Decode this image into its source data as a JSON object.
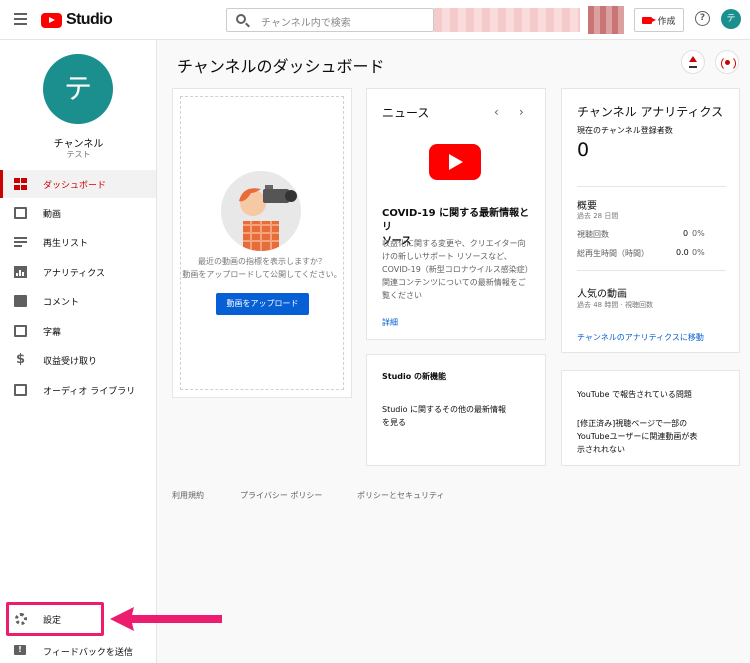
{
  "header": {
    "logo_text": "Studio",
    "search_placeholder": "チャンネル内で検索",
    "create_label": "作成",
    "help_label": "?",
    "avatar_initial": "テ"
  },
  "sidebar": {
    "avatar_initial": "テ",
    "channel_name": "チャンネル",
    "channel_sub": "テスト",
    "items": [
      {
        "label": "ダッシュボード",
        "icon": "dashboard-icon"
      },
      {
        "label": "動画",
        "icon": "video-icon"
      },
      {
        "label": "再生リスト",
        "icon": "playlist-icon"
      },
      {
        "label": "アナリティクス",
        "icon": "analytics-icon"
      },
      {
        "label": "コメント",
        "icon": "comment-icon"
      },
      {
        "label": "字幕",
        "icon": "subtitles-icon"
      },
      {
        "label": "収益受け取り",
        "icon": "dollar-icon"
      },
      {
        "label": "オーディオ ライブラリ",
        "icon": "audio-library-icon"
      }
    ],
    "settings_label": "設定",
    "feedback_label": "フィードバックを送信"
  },
  "main": {
    "title": "チャンネルのダッシュボード",
    "upload_card": {
      "text_line1": "最近の動画の指標を表示しますか？",
      "text_line2": "動画をアップロードして公開してください。",
      "button": "動画をアップロード"
    },
    "news": {
      "heading": "ニュース",
      "title_line1": "COVID-19 に関する最新情報とリ",
      "title_line2": "ソース",
      "body_lines": [
        "収益化に関する変更や、クリエイター向",
        "けの新しいサポート リソースなど、",
        "COVID-19（新型コロナウイルス感染症）",
        "関連コンテンツについての最新情報をご",
        "覧ください"
      ],
      "link": "詳細"
    },
    "whats_new": {
      "heading": "Studio の新機能",
      "body_line1": "Studio に関するその他の最新情報",
      "body_line2": "を見る"
    },
    "analytics": {
      "title": "チャンネル アナリティクス",
      "subs_label": "現在のチャンネル登録者数",
      "subs_value": "0",
      "summary_heading": "概要",
      "summary_period": "過去 28 日間",
      "views_label": "視聴回数",
      "views_value": "0",
      "views_pct": "0%",
      "watch_label": "総再生時間（時間）",
      "watch_value": "0.0",
      "watch_pct": "0%",
      "popular_heading": "人気の動画",
      "popular_period": "過去 48 時間 · 視聴回数",
      "link": "チャンネルのアナリティクスに移動"
    },
    "issues": {
      "heading": "YouTube で報告されている問題",
      "body_line1": "[修正済み]視聴ページで一部の",
      "body_line2": "YouTubeユーザーに関連動画が表",
      "body_line3": "示されれない"
    },
    "footer": [
      "利用規約",
      "プライバシー ポリシー",
      "ポリシーとセキュリティ"
    ]
  },
  "colors": {
    "accent_red": "#cc0000",
    "link_blue": "#065fd4",
    "avatar_teal": "#1b8f8d",
    "highlight_pink": "#ec1c6e"
  }
}
